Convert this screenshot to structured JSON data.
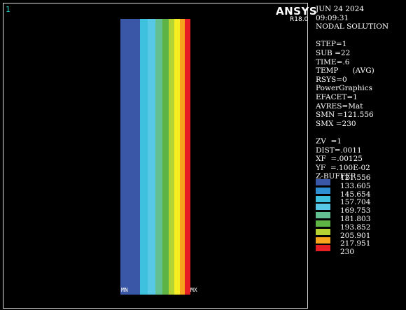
{
  "window": {
    "number": "1",
    "logo": "ANSYS",
    "release": "R18.0"
  },
  "info_lines": [
    "JUN 24 2024",
    "09:09:31",
    "NODAL SOLUTION",
    "",
    "STEP=1",
    "SUB =22",
    "TIME=.6",
    "TEMP      (AVG)",
    "RSYS=0",
    "PowerGraphics",
    "EFACET=1",
    "AVRES=Mat",
    "SMN =121.556",
    "SMX =230",
    "",
    "ZV  =1",
    "DIST=.0011",
    "XF  =.00125",
    "YF  =.100E-02",
    "Z-BUFFER"
  ],
  "model": {
    "min_label": "MN",
    "max_label": "MX"
  },
  "legend": [
    {
      "value": "121.556",
      "color": "#3a56a6"
    },
    {
      "value": "133.605",
      "color": "#2e8fd3"
    },
    {
      "value": "145.654",
      "color": "#3ec0df"
    },
    {
      "value": "157.704",
      "color": "#57c9e6"
    },
    {
      "value": "169.753",
      "color": "#63c090"
    },
    {
      "value": "181.803",
      "color": "#5db444"
    },
    {
      "value": "193.852",
      "color": "#b5d333"
    },
    {
      "value": "205.901",
      "color": "#f6ee22"
    },
    {
      "value": "217.951",
      "color": "#f6a51c"
    },
    {
      "value": "230",
      "color": "#e81e25"
    }
  ],
  "band_colors": [
    "#3a56a6",
    "#3ec0df",
    "#57c9e6",
    "#63c090",
    "#5db444",
    "#b5d333",
    "#f6ee22",
    "#f6a51c",
    "#e81e25"
  ]
}
